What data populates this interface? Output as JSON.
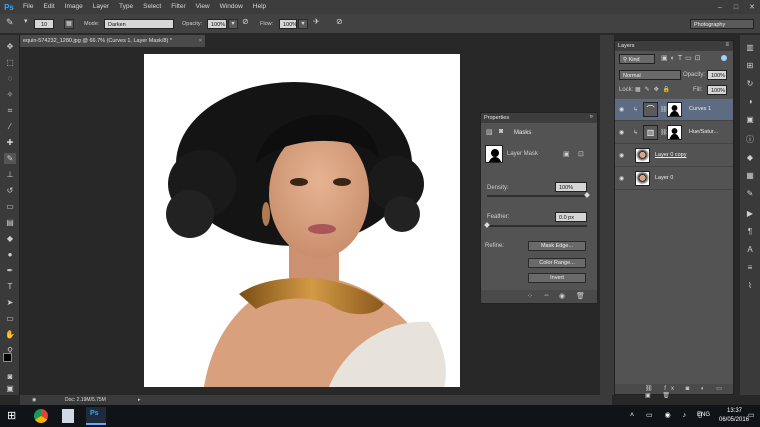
{
  "menubar": {
    "app_logo": "Ps",
    "items": [
      "File",
      "Edit",
      "Image",
      "Layer",
      "Type",
      "Select",
      "Filter",
      "View",
      "Window",
      "Help"
    ]
  },
  "options": {
    "brush_size": "10",
    "mode_label": "Mode:",
    "mode_value": "Darken",
    "opacity_label": "Opacity:",
    "opacity_value": "100%",
    "flow_label": "Flow:",
    "flow_value": "100%",
    "workspace": "Photography"
  },
  "document": {
    "tab_title": "equin-574232_1280.jpg @ 66.7% (Curves 1, Layer Mask/8) *",
    "status": "Doc: 2.19M/5.75M"
  },
  "properties": {
    "title": "Properties",
    "section": "Masks",
    "mask_label": "Layer Mask",
    "density_label": "Density:",
    "density_value": "100%",
    "density_fraction": 1.0,
    "feather_label": "Feather:",
    "feather_value": "0.0 px",
    "feather_fraction": 0.0,
    "refine_label": "Refine:",
    "buttons": [
      "Mask Edge...",
      "Color Range...",
      "Invert"
    ]
  },
  "layers": {
    "title": "Layers",
    "kind_value": "Kind",
    "blend_value": "Normal",
    "opacity_label": "Opacity:",
    "opacity_value": "100%",
    "lock_label": "Lock:",
    "fill_label": "Fill:",
    "fill_value": "100%",
    "rows": [
      {
        "name": "Curves 1",
        "selected": true
      },
      {
        "name": "Hue/Satur...",
        "selected": false
      },
      {
        "name": "Layer 0 copy",
        "selected": false
      },
      {
        "name": "Layer 0",
        "selected": false
      }
    ]
  },
  "taskbar": {
    "language": "ENG",
    "time": "13:37",
    "date": "06/05/2016"
  },
  "colors": {
    "accent": "#31a8ff",
    "selected_layer": "#5d6c82",
    "panel": "#535353"
  }
}
